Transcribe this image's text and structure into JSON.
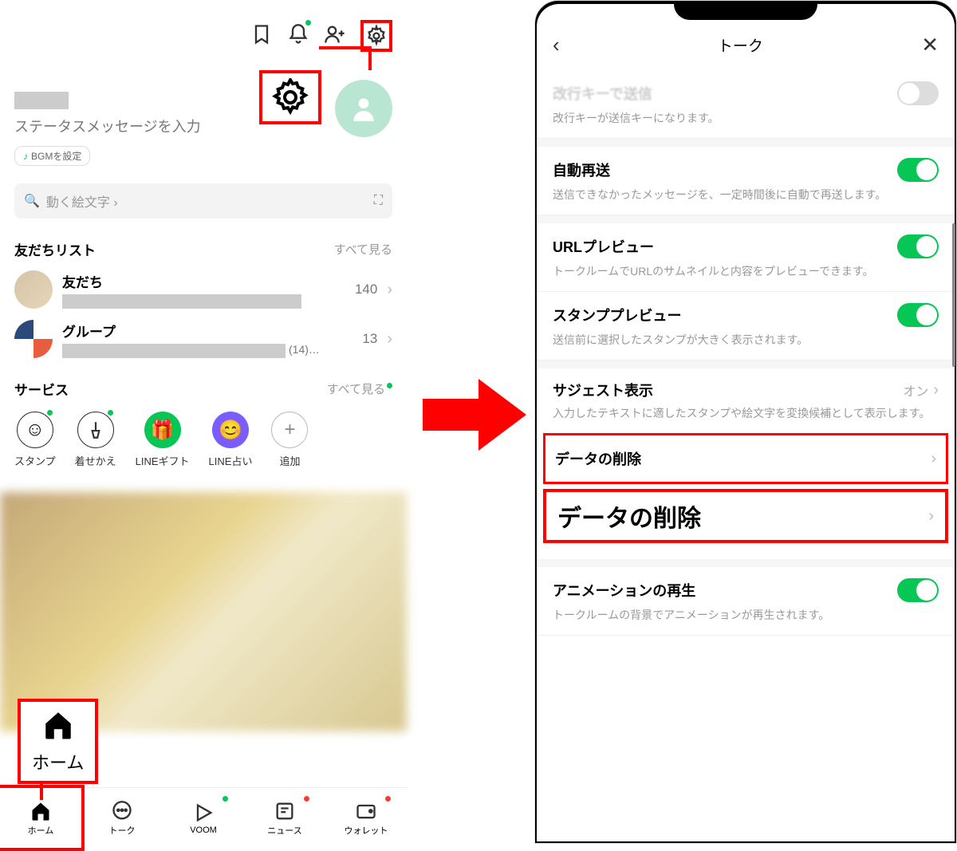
{
  "left": {
    "status_placeholder": "ステータスメッセージを入力",
    "bgm_label": "BGMを設定",
    "search_placeholder": "動く絵文字",
    "friends_section": "友だちリスト",
    "see_all": "すべて見る",
    "friends_row": {
      "label": "友だち",
      "count": "140"
    },
    "group_row": {
      "label": "グループ",
      "count": "13",
      "extra": "(14)…"
    },
    "service_section": "サービス",
    "services": [
      {
        "label": "スタンプ"
      },
      {
        "label": "着せかえ"
      },
      {
        "label": "LINEギフト"
      },
      {
        "label": "LINE占い"
      },
      {
        "label": "追加"
      }
    ],
    "home_callout": "ホーム",
    "tabs": [
      {
        "label": "ホーム"
      },
      {
        "label": "トーク"
      },
      {
        "label": "VOOM"
      },
      {
        "label": "ニュース"
      },
      {
        "label": "ウォレット"
      }
    ]
  },
  "right": {
    "title": "トーク",
    "enter_send": {
      "title": "改行キーで送信",
      "desc": "改行キーが送信キーになります。"
    },
    "resend": {
      "title": "自動再送",
      "desc": "送信できなかったメッセージを、一定時間後に自動で再送します。"
    },
    "url_preview": {
      "title": "URLプレビュー",
      "desc": "トークルームでURLのサムネイルと内容をプレビューできます。"
    },
    "stamp_preview": {
      "title": "スタンププレビュー",
      "desc": "送信前に選択したスタンプが大きく表示されます。"
    },
    "suggest": {
      "title": "サジェスト表示",
      "value": "オン",
      "desc": "入力したテキストに適したスタンプや絵文字を変換候補として表示します。"
    },
    "data_delete": "データの削除",
    "data_delete_callout": "データの削除",
    "animation": {
      "title": "アニメーションの再生",
      "desc": "トークルームの背景でアニメーションが再生されます。"
    }
  }
}
